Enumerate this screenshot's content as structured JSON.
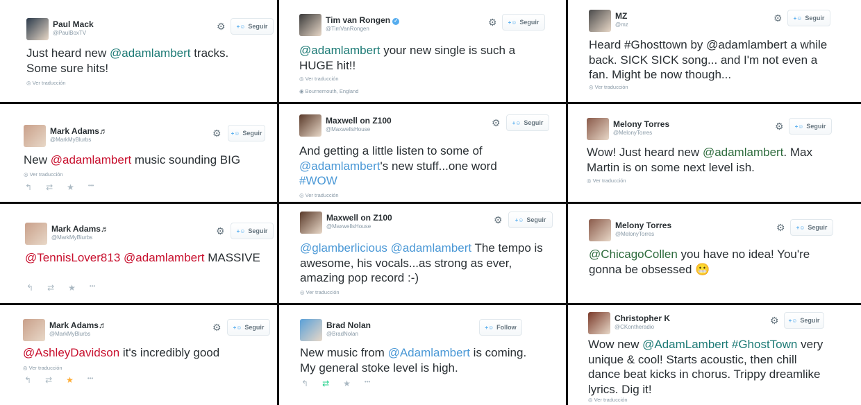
{
  "tweets": [
    {
      "name": "Paul Mack",
      "handle": "@PaulBoxTV",
      "button": "Seguir",
      "text": [
        {
          "t": "Just heard new "
        },
        {
          "t": "@adamlambert",
          "c": "teal"
        },
        {
          "t": " tracks. Some sure hits!"
        }
      ],
      "translate": "Ver traducción",
      "avatar_color": "#2b3a4a"
    },
    {
      "name": "Tim van Rongen",
      "handle": "@TimVanRongen",
      "button": "Seguir",
      "verified": true,
      "text": [
        {
          "t": "@adamlambert",
          "c": "teal"
        },
        {
          "t": " your new single is such a HUGE hit!!"
        }
      ],
      "translate": "Ver traducción",
      "location": "Bournemouth, England",
      "avatar_color": "#3a3a3a"
    },
    {
      "name": "MZ",
      "handle": "@mz",
      "button": "Seguir",
      "text": [
        {
          "t": "Heard #Ghosttown by @adamlambert a while back. SICK SICK song... and I'm not even a fan. Might be now though..."
        }
      ],
      "translate": "Ver traducción",
      "avatar_color": "#4a4a4a"
    },
    {
      "name": "Mark Adams♬",
      "handle": "@MarkMyBlurbs",
      "button": "Seguir",
      "text": [
        {
          "t": "New "
        },
        {
          "t": "@adamlambert",
          "c": "red"
        },
        {
          "t": " music sounding BIG"
        }
      ],
      "translate": "Ver traducción",
      "avatar_color": "#c9a08a"
    },
    {
      "name": "Maxwell on Z100",
      "handle": "@MaxwellsHouse",
      "button": "Seguir",
      "text": [
        {
          "t": "And getting a little listen to some of "
        },
        {
          "t": "@adamlambert",
          "c": "blue"
        },
        {
          "t": "'s new stuff...one word "
        },
        {
          "t": "#WOW",
          "c": "blue"
        }
      ],
      "translate": "Ver traducción",
      "avatar_color": "#5a3a2a"
    },
    {
      "name": "Melony Torres",
      "handle": "@MelonyTorres",
      "button": "Seguir",
      "text": [
        {
          "t": "Wow! Just heard new "
        },
        {
          "t": "@adamlambert",
          "c": "green"
        },
        {
          "t": ". Max Martin is on some next level ish."
        }
      ],
      "translate": "Ver traducción",
      "avatar_color": "#8a5a4a"
    },
    {
      "name": "Mark Adams♬",
      "handle": "@MarkMyBlurbs",
      "button": "Seguir",
      "text": [
        {
          "t": "@TennisLover813",
          "c": "red"
        },
        {
          "t": " "
        },
        {
          "t": "@adamlambert",
          "c": "red"
        },
        {
          "t": " MASSIVE"
        }
      ],
      "translate": "",
      "avatar_color": "#c9a08a"
    },
    {
      "name": "Maxwell on Z100",
      "handle": "@MaxwellsHouse",
      "button": "Seguir",
      "text": [
        {
          "t": "@glamberlicious",
          "c": "blue"
        },
        {
          "t": " "
        },
        {
          "t": "@adamlambert",
          "c": "blue"
        },
        {
          "t": " The tempo is awesome, his vocals...as strong as ever, amazing pop record :-)"
        }
      ],
      "translate": "Ver traducción",
      "avatar_color": "#5a3a2a"
    },
    {
      "name": "Melony Torres",
      "handle": "@MelonyTorres",
      "button": "Seguir",
      "text": [
        {
          "t": "@ChicagoCollen",
          "c": "green"
        },
        {
          "t": " you have no idea! You're gonna be obsessed 😬"
        }
      ],
      "translate": "",
      "avatar_color": "#8a5a4a"
    },
    {
      "name": "Mark Adams♬",
      "handle": "@MarkMyBlurbs",
      "button": "Seguir",
      "text": [
        {
          "t": "@AshleyDavidson",
          "c": "red"
        },
        {
          "t": " it's incredibly good"
        }
      ],
      "translate": "Ver traducción",
      "avatar_color": "#c9a08a"
    },
    {
      "name": "Brad Nolan",
      "handle": "@BradNolan",
      "button": "Follow",
      "text": [
        {
          "t": "New music from "
        },
        {
          "t": "@Adamlambert",
          "c": "blue"
        },
        {
          "t": " is coming. My general stoke level is high."
        }
      ],
      "translate": "",
      "avatar_color": "#5aa0d8"
    },
    {
      "name": "Christopher K",
      "handle": "@CKontheradio",
      "button": "Seguir",
      "text": [
        {
          "t": "Wow new "
        },
        {
          "t": "@AdamLambert",
          "c": "teal"
        },
        {
          "t": " "
        },
        {
          "t": "#GhostTown",
          "c": "teal"
        },
        {
          "t": " very unique & cool! Starts acoustic, then chill dance beat kicks in chorus. Trippy dreamlike lyrics. Dig it!"
        }
      ],
      "translate": "Ver traducción",
      "avatar_color": "#7a3a2a"
    }
  ],
  "icons": {
    "gear": "gear-icon",
    "follow": "follow-person-icon",
    "reply": "reply-icon",
    "retweet": "retweet-icon",
    "favorite": "favorite-icon",
    "more": "more-icon",
    "translate": "globe-icon",
    "location": "location-pin-icon"
  }
}
